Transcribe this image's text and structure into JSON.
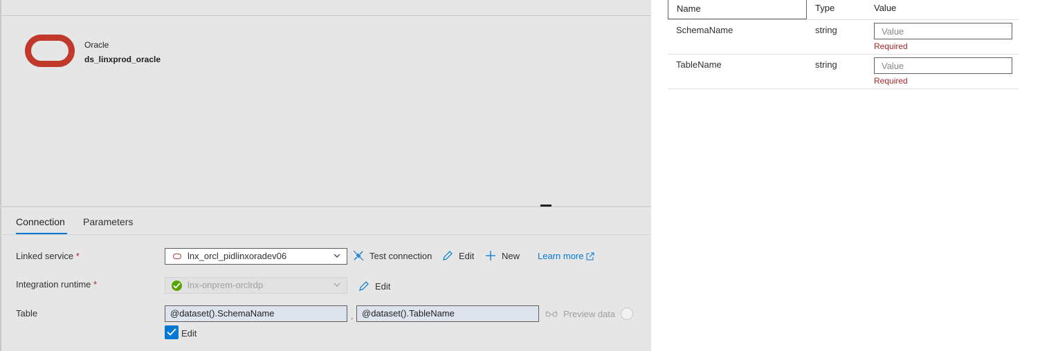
{
  "dataset": {
    "type_label": "Oracle",
    "name": "ds_linxprod_oracle"
  },
  "tabs": [
    {
      "label": "Connection",
      "active": true
    },
    {
      "label": "Parameters",
      "active": false
    }
  ],
  "form": {
    "linked_service": {
      "label": "Linked service",
      "required_mark": "*",
      "value": "lnx_orcl_pidlinxoradev06",
      "test_connection": "Test connection",
      "edit": "Edit",
      "new": "New",
      "learn_more": "Learn more"
    },
    "integration_runtime": {
      "label": "Integration runtime",
      "required_mark": "*",
      "value": "lnx-onprem-orclrdp",
      "edit": "Edit"
    },
    "table": {
      "label": "Table",
      "schema_value": "@dataset().SchemaName",
      "separator": ".",
      "table_value": "@dataset().TableName",
      "preview_data": "Preview data",
      "edit_checkbox_label": "Edit",
      "edit_checked": true
    }
  },
  "parameters": {
    "headers": {
      "name": "Name",
      "type": "Type",
      "value": "Value"
    },
    "rows": [
      {
        "name": "SchemaName",
        "type": "string",
        "placeholder": "Value",
        "error": "Required"
      },
      {
        "name": "TableName",
        "type": "string",
        "placeholder": "Value",
        "error": "Required"
      }
    ]
  },
  "colors": {
    "accent": "#0078d4",
    "oracle_red": "#c0392b",
    "error": "#a4262c",
    "success": "#57a300"
  }
}
